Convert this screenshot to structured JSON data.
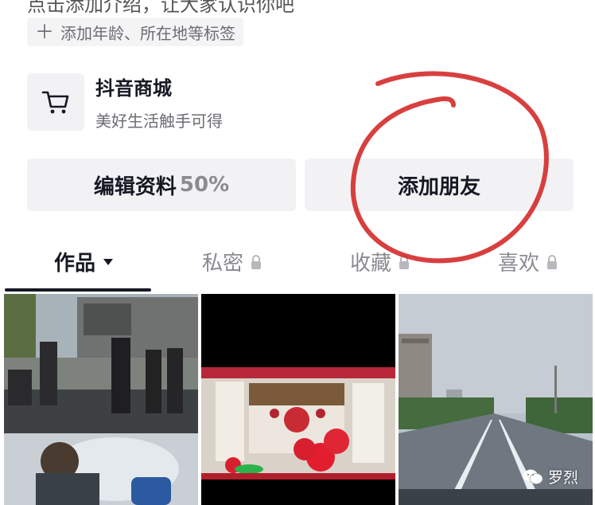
{
  "profile": {
    "top_cut_text": "点击添加介绍，让大家认识你吧",
    "tag_chip_label": "添加年龄、所在地等标签"
  },
  "shop": {
    "title": "抖音商城",
    "subtitle": "美好生活触手可得",
    "icon": "shopping-cart-icon"
  },
  "actions": {
    "edit_label": "编辑资料",
    "edit_progress": "50%",
    "add_friend_label": "添加朋友"
  },
  "tabs": [
    {
      "label": "作品",
      "active": true,
      "icon": "caret-down-icon"
    },
    {
      "label": "私密",
      "active": false,
      "icon": "lock-icon"
    },
    {
      "label": "收藏",
      "active": false,
      "icon": "lock-icon"
    },
    {
      "label": "喜欢",
      "active": false,
      "icon": "lock-icon"
    }
  ],
  "grid": {
    "items": [
      {
        "scene": "street-people-photo"
      },
      {
        "scene": "festive-red-decorations-photo"
      },
      {
        "scene": "road-city-photo"
      }
    ]
  },
  "watermark": {
    "text": "罗烈",
    "icon": "wechat-icon"
  },
  "colors": {
    "annotation_red": "#d42a2a",
    "chip_bg": "#f4f4f5",
    "text_dark": "#161823",
    "text_gray": "#8a8b91"
  }
}
